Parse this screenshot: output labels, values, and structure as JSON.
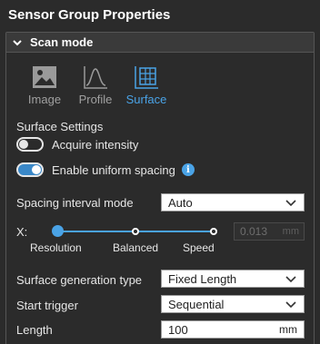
{
  "panel": {
    "title": "Sensor Group Properties"
  },
  "section": {
    "title": "Scan mode",
    "expanded": true
  },
  "modes": [
    {
      "label": "Image",
      "icon": "image-icon",
      "active": false
    },
    {
      "label": "Profile",
      "icon": "profile-icon",
      "active": false
    },
    {
      "label": "Surface",
      "icon": "surface-icon",
      "active": true
    }
  ],
  "surface_settings": {
    "title": "Surface Settings",
    "acquire_intensity": {
      "label": "Acquire intensity",
      "on": false
    },
    "uniform_spacing": {
      "label": "Enable uniform spacing",
      "on": true,
      "info_icon": "info-icon"
    }
  },
  "spacing": {
    "mode_label": "Spacing interval mode",
    "mode_value": "Auto",
    "slider_axis_label": "X:",
    "stops": [
      "Resolution",
      "Balanced",
      "Speed"
    ],
    "value": "0.013",
    "unit": "mm"
  },
  "generation": {
    "label": "Surface generation type",
    "value": "Fixed Length"
  },
  "trigger": {
    "label": "Start trigger",
    "value": "Sequential"
  },
  "length": {
    "label": "Length",
    "value": "100",
    "unit": "mm"
  },
  "colors": {
    "accent": "#4aa3e6",
    "background": "#2b2b2b"
  }
}
